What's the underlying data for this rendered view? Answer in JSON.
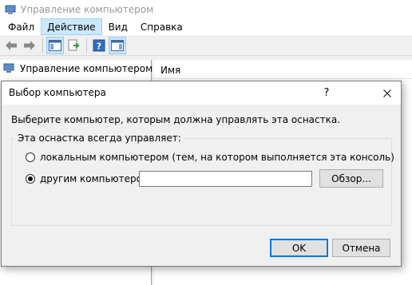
{
  "window": {
    "title": "Управление компьютером"
  },
  "menubar": {
    "items": [
      "Файл",
      "Действие",
      "Вид",
      "Справка"
    ],
    "active_item": "Действие"
  },
  "toolbar": {
    "icons": [
      "back-arrow-icon",
      "forward-arrow-icon",
      "show-hide-tree-icon",
      "export-list-icon",
      "help-icon",
      "show-action-pane-icon"
    ]
  },
  "tree": {
    "root_label": "Управление компьютером (л"
  },
  "list": {
    "column_name": "Имя"
  },
  "dialog": {
    "title": "Выбор компьютера",
    "help_glyph": "?",
    "prompt": "Выберите компьютер, которым должна управлять эта оснастка.",
    "group_label": "Эта оснастка всегда управляет:",
    "option_local": "локальным компьютером  (тем, на котором выполняется эта консоль)",
    "option_other": "другим компьютером:",
    "selected_option": "other",
    "computer_value": "",
    "browse_label": "Обзор...",
    "ok_label": "OK",
    "cancel_label": "Отмена"
  },
  "colors": {
    "active_menu_bg": "#cce8ff",
    "dialog_bg": "#f0f0f0",
    "default_button_border": "#0078d7"
  }
}
